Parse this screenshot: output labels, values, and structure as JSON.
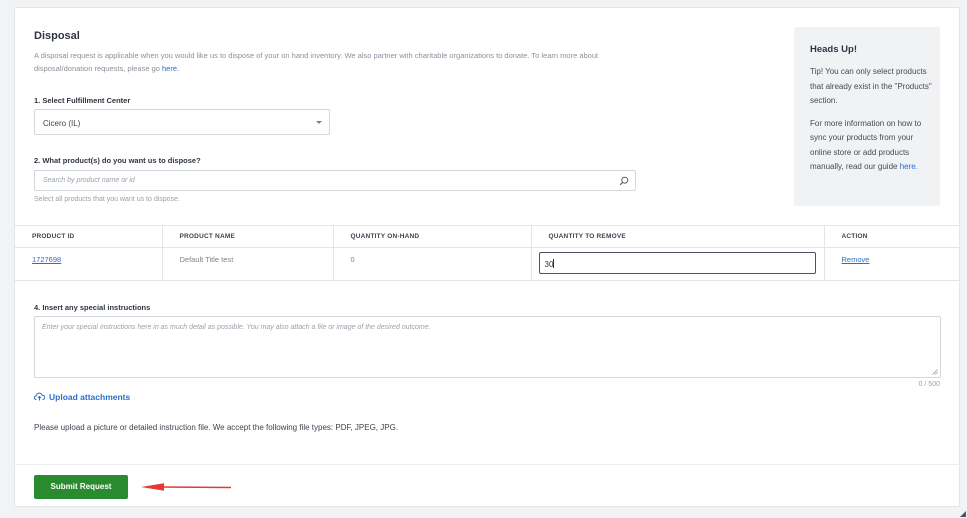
{
  "section": {
    "title": "Disposal",
    "description": "A disposal request is applicable when you would like us to dispose of your on hand inventory. We also partner with charitable organizations to donate. To learn more about disposal/donation requests, please go",
    "description_link": "here."
  },
  "fulfillment": {
    "label": "1. Select Fulfillment Center",
    "selected": "Cicero (IL)"
  },
  "products": {
    "label": "2. What product(s) do you want us to dispose?",
    "search_placeholder": "Search by product name or id",
    "help": "Select all products that you want us to dispose."
  },
  "tip": {
    "heading": "Heads Up!",
    "p1": "Tip! You can only select products that already exist in the \"Products\" section.",
    "p2": "For more information on how to sync your products from your online store or add products manually, read our guide",
    "p2_link": "here."
  },
  "table": {
    "headers": [
      "PRODUCT ID",
      "PRODUCT NAME",
      "QUANTITY ON-HAND",
      "QUANTITY TO REMOVE",
      "ACTION"
    ],
    "rows": [
      {
        "product_id": "1727698",
        "product_name": "Default Title test",
        "on_hand": "0",
        "to_remove": "30",
        "action": "Remove"
      }
    ]
  },
  "instructions": {
    "label": "4. Insert any special instructions",
    "placeholder": "Enter your special instructions here in as much detail as possible. You may also attach a file or image of the desired outcome.",
    "counter": "0 / 500"
  },
  "upload": {
    "label": "Upload attachments",
    "note": "Please upload a picture or detailed instruction file. We accept the following file types: PDF, JPEG, JPG."
  },
  "submit_label": "Submit Request",
  "colors": {
    "accent_link": "#2c6ecb",
    "submit_green": "#2a8a2f",
    "annotation_arrow": "#e53935"
  },
  "icons": [
    "chevron-down-icon",
    "search-icon",
    "upload-cloud-icon",
    "resize-grip-icon",
    "annotation-arrow-icon"
  ]
}
